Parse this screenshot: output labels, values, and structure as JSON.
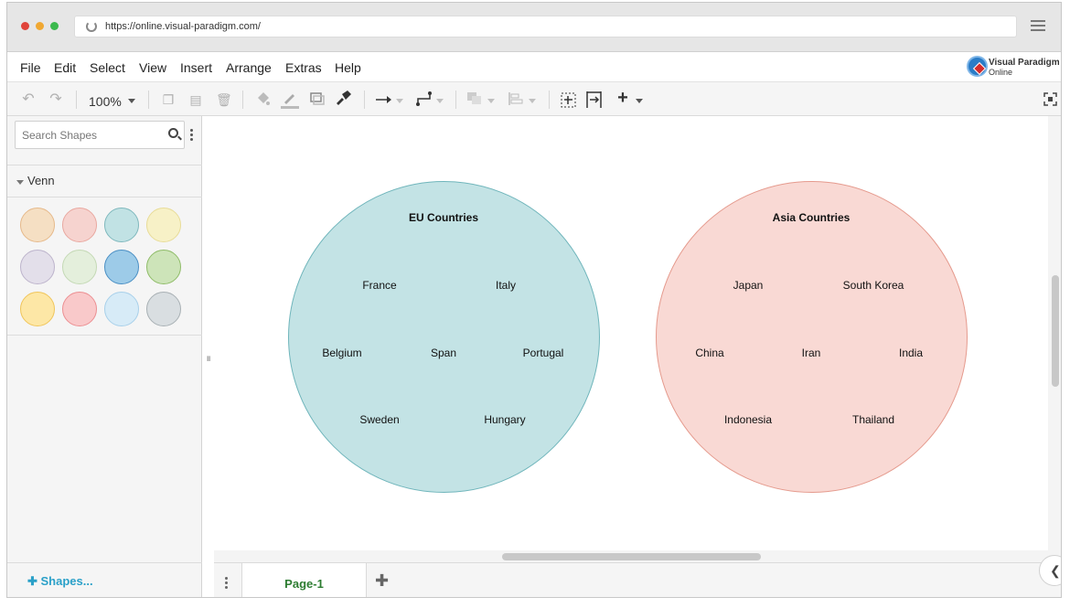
{
  "browser": {
    "url": "https://online.visual-paradigm.com/",
    "dots": [
      "#e0443a",
      "#f0a832",
      "#3cb94e"
    ]
  },
  "menu": {
    "items": [
      "File",
      "Edit",
      "Select",
      "View",
      "Insert",
      "Arrange",
      "Extras",
      "Help"
    ],
    "logo_line1": "Visual Paradigm",
    "logo_line2": "Online"
  },
  "toolbar": {
    "zoom": "100%"
  },
  "sidebar": {
    "search_placeholder": "Search Shapes",
    "section_title": "Venn",
    "swatches": [
      {
        "fill": "#f5dfc3",
        "stroke": "#e6b98a"
      },
      {
        "fill": "#f6d3cf",
        "stroke": "#e9a8a0"
      },
      {
        "fill": "#c1e2e4",
        "stroke": "#7fb8bd"
      },
      {
        "fill": "#f7f1c7",
        "stroke": "#e8dc98"
      },
      {
        "fill": "#e3dfea",
        "stroke": "#bdb4cc"
      },
      {
        "fill": "#e4efdc",
        "stroke": "#c4d9b5"
      },
      {
        "fill": "#9dcbe8",
        "stroke": "#4a8fc4"
      },
      {
        "fill": "#cde4b9",
        "stroke": "#8fbc68"
      },
      {
        "fill": "#fde7a6",
        "stroke": "#f0c55a"
      },
      {
        "fill": "#f9c9ca",
        "stroke": "#ec8f92"
      },
      {
        "fill": "#d7ebf7",
        "stroke": "#a8d0ea"
      },
      {
        "fill": "#d9dee1",
        "stroke": "#a8b0b4"
      }
    ],
    "shapes_link": "Shapes..."
  },
  "diagram": {
    "eu": {
      "title": "EU Countries",
      "fill": "#c3e3e5",
      "stroke": "#6fb5bb",
      "labels": [
        "France",
        "Italy",
        "Belgium",
        "Span",
        "Portugal",
        "Sweden",
        "Hungary"
      ]
    },
    "asia": {
      "title": "Asia Countries",
      "fill": "#f9d9d4",
      "stroke": "#e59a8d",
      "labels": [
        "Japan",
        "South Korea",
        "China",
        "Iran",
        "India",
        "Indonesia",
        "Thailand"
      ]
    }
  },
  "bottom": {
    "page_tab": "Page-1"
  }
}
